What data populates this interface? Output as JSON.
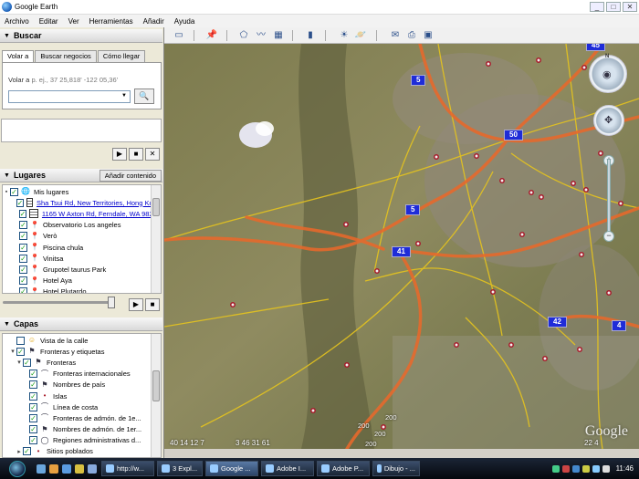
{
  "window": {
    "title": "Google Earth",
    "controls": [
      "_",
      "□",
      "✕"
    ]
  },
  "menu": [
    "Archivo",
    "Editar",
    "Ver",
    "Herramientas",
    "Añadir",
    "Ayuda"
  ],
  "search": {
    "header": "Buscar",
    "tabs": [
      "Volar a",
      "Buscar negocios",
      "Cómo llegar"
    ],
    "fly_label": "Volar a",
    "fly_hint": "p. ej., 37 25,818' -122 05,36'",
    "input_value": ""
  },
  "places": {
    "header": "Lugares",
    "add_content": "Añadir contenido",
    "items": [
      {
        "label": "Mis lugares",
        "icon": "folder-icon",
        "checked": true,
        "indent": 0,
        "link": false
      },
      {
        "label": "Sha Tsui Rd, New Territories, Hong Kong",
        "icon": "grid-icon",
        "checked": true,
        "indent": 1,
        "link": true
      },
      {
        "label": "1165 W Axton Rd, Ferndale, WA 98248",
        "icon": "grid-icon",
        "checked": true,
        "indent": 1,
        "link": true
      },
      {
        "label": "Observatorio Los angeles",
        "icon": "pushpin-icon",
        "checked": true,
        "indent": 1,
        "link": false
      },
      {
        "label": "Verò",
        "icon": "pushpin-icon",
        "checked": true,
        "indent": 1,
        "link": false
      },
      {
        "label": "Piscina chula",
        "icon": "pushpin-icon",
        "checked": true,
        "indent": 1,
        "link": false
      },
      {
        "label": "Vinitsa",
        "icon": "pushpin-icon",
        "checked": true,
        "indent": 1,
        "link": false
      },
      {
        "label": "Grupotel taurus Park",
        "icon": "pushpin-icon",
        "checked": true,
        "indent": 1,
        "link": false
      },
      {
        "label": "Hotel Aya",
        "icon": "pushpin-icon",
        "checked": true,
        "indent": 1,
        "link": false
      },
      {
        "label": "Hotel Plutardo",
        "icon": "pushpin-icon",
        "checked": true,
        "indent": 1,
        "link": false
      }
    ]
  },
  "layers": {
    "header": "Capas",
    "items": [
      {
        "label": "Vista de la calle",
        "icon": "pegman-icon",
        "checked": false,
        "indent": 1
      },
      {
        "label": "Fronteras y etiquetas",
        "icon": "flag-icon",
        "checked": true,
        "indent": 1
      },
      {
        "label": "Fronteras",
        "icon": "flag-icon",
        "checked": true,
        "indent": 2
      },
      {
        "label": "Fronteras internacionales",
        "icon": "border-line-icon",
        "checked": true,
        "indent": 3
      },
      {
        "label": "Nombres de país",
        "icon": "flag-icon",
        "checked": true,
        "indent": 3
      },
      {
        "label": "Islas",
        "icon": "dot-icon",
        "checked": true,
        "indent": 3
      },
      {
        "label": "Línea de costa",
        "icon": "border-line-icon",
        "checked": true,
        "indent": 3
      },
      {
        "label": "Fronteras de admón. de 1e...",
        "icon": "border-line-icon",
        "checked": true,
        "indent": 3
      },
      {
        "label": "Nombres de admón. de 1er...",
        "icon": "flag-icon",
        "checked": true,
        "indent": 3
      },
      {
        "label": "Regiones administrativas d...",
        "icon": "region-icon",
        "checked": true,
        "indent": 3
      },
      {
        "label": "Sitios poblados",
        "icon": "dot-icon",
        "checked": true,
        "indent": 2
      }
    ]
  },
  "map": {
    "shields": [
      "5",
      "50",
      "5",
      "41",
      "42",
      "4",
      "45"
    ],
    "road_labels": [
      "200",
      "200",
      "200",
      "200"
    ],
    "status_left": "40 14 12 7",
    "status_mid": "3 46 31 61",
    "status_right": "22 4",
    "logo": "Google",
    "compass_north": "N"
  },
  "taskbar": {
    "tasks": [
      {
        "label": "http://w...",
        "active": false
      },
      {
        "label": "3 Expl...",
        "active": false
      },
      {
        "label": "Google ...",
        "active": true
      },
      {
        "label": "Adobe I...",
        "active": false
      },
      {
        "label": "Adobe P...",
        "active": false
      },
      {
        "label": "Dibujo - ...",
        "active": false
      }
    ],
    "time": "11:46"
  },
  "colors": {
    "highway": "#e8692b",
    "road_yellow": "#e6c41e",
    "shield": "#1f2cd8",
    "accent": "#21a121"
  }
}
